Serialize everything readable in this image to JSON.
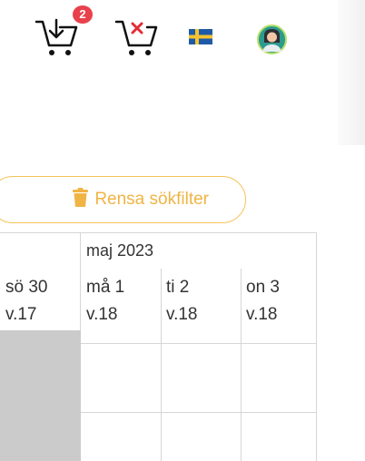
{
  "header": {
    "cart_add_badge": "2",
    "cart_add_icon": "cart-download-icon",
    "cart_remove_icon": "cart-remove-icon",
    "language_flag": "sweden-flag-icon",
    "avatar_icon": "user-avatar-icon"
  },
  "filter": {
    "clear_label": "Rensa sökfilter"
  },
  "calendar": {
    "month": "maj 2023",
    "days": [
      {
        "day": "sö 30",
        "week": "v.17"
      },
      {
        "day": "må 1",
        "week": "v.18"
      },
      {
        "day": "ti 2",
        "week": "v.18"
      },
      {
        "day": "on 3",
        "week": "v.18"
      }
    ]
  },
  "colors": {
    "accent": "#f0b445",
    "badge": "#e8414c",
    "grid": "#d6d6d6",
    "unavailable": "#cbcbcb"
  }
}
